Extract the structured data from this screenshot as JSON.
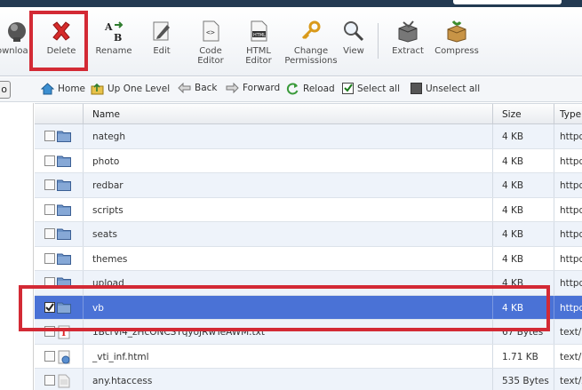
{
  "toolbar": {
    "download_label": "ownloa",
    "delete_label": "Delete",
    "rename_label": "Rename",
    "edit_label": "Edit",
    "code_editor_label_1": "Code",
    "code_editor_label_2": "Editor",
    "html_editor_label_1": "HTML",
    "html_editor_label_2": "Editor",
    "change_perm_label_1": "Change",
    "change_perm_label_2": "Permissions",
    "view_label": "View",
    "extract_label": "Extract",
    "compress_label": "Compress",
    "html_icon_text": "HTML"
  },
  "nav": {
    "go_label": "o",
    "home": "Home",
    "up_one_level": "Up One Level",
    "back": "Back",
    "forward": "Forward",
    "reload": "Reload",
    "select_all": "Select all",
    "unselect_all": "Unselect all"
  },
  "table": {
    "columns": {
      "name": "Name",
      "size": "Size",
      "type": "Type"
    },
    "rows": [
      {
        "name": "nategh",
        "size": "4 KB",
        "type": "httpd",
        "icon": "folder-icon",
        "checked": false
      },
      {
        "name": "photo",
        "size": "4 KB",
        "type": "httpd",
        "icon": "folder-icon",
        "checked": false
      },
      {
        "name": "redbar",
        "size": "4 KB",
        "type": "httpd",
        "icon": "folder-icon",
        "checked": false
      },
      {
        "name": "scripts",
        "size": "4 KB",
        "type": "httpd",
        "icon": "folder-icon",
        "checked": false
      },
      {
        "name": "seats",
        "size": "4 KB",
        "type": "httpd",
        "icon": "folder-icon",
        "checked": false
      },
      {
        "name": "themes",
        "size": "4 KB",
        "type": "httpd",
        "icon": "folder-icon",
        "checked": false
      },
      {
        "name": "upload",
        "size": "4 KB",
        "type": "httpd",
        "icon": "folder-icon",
        "checked": false
      },
      {
        "name": "vb",
        "size": "4 KB",
        "type": "httpd",
        "icon": "folder-icon",
        "checked": true,
        "selected": true
      },
      {
        "name": "1Bcrvl4_zHcONCSTqyoJRwTeAWM.txt",
        "size": "67 Bytes",
        "type": "text/p",
        "icon": "text-file-icon",
        "checked": false
      },
      {
        "name": "_vti_inf.html",
        "size": "1.71 KB",
        "type": "text/h",
        "icon": "html-file-icon",
        "checked": false
      },
      {
        "name": "any.htaccess",
        "size": "535 Bytes",
        "type": "text/x",
        "icon": "file-icon",
        "checked": false
      }
    ]
  },
  "colors": {
    "selected_row": "#4a72d6",
    "highlight_red": "#d32a35",
    "row_stripe": "#eef3fa"
  }
}
